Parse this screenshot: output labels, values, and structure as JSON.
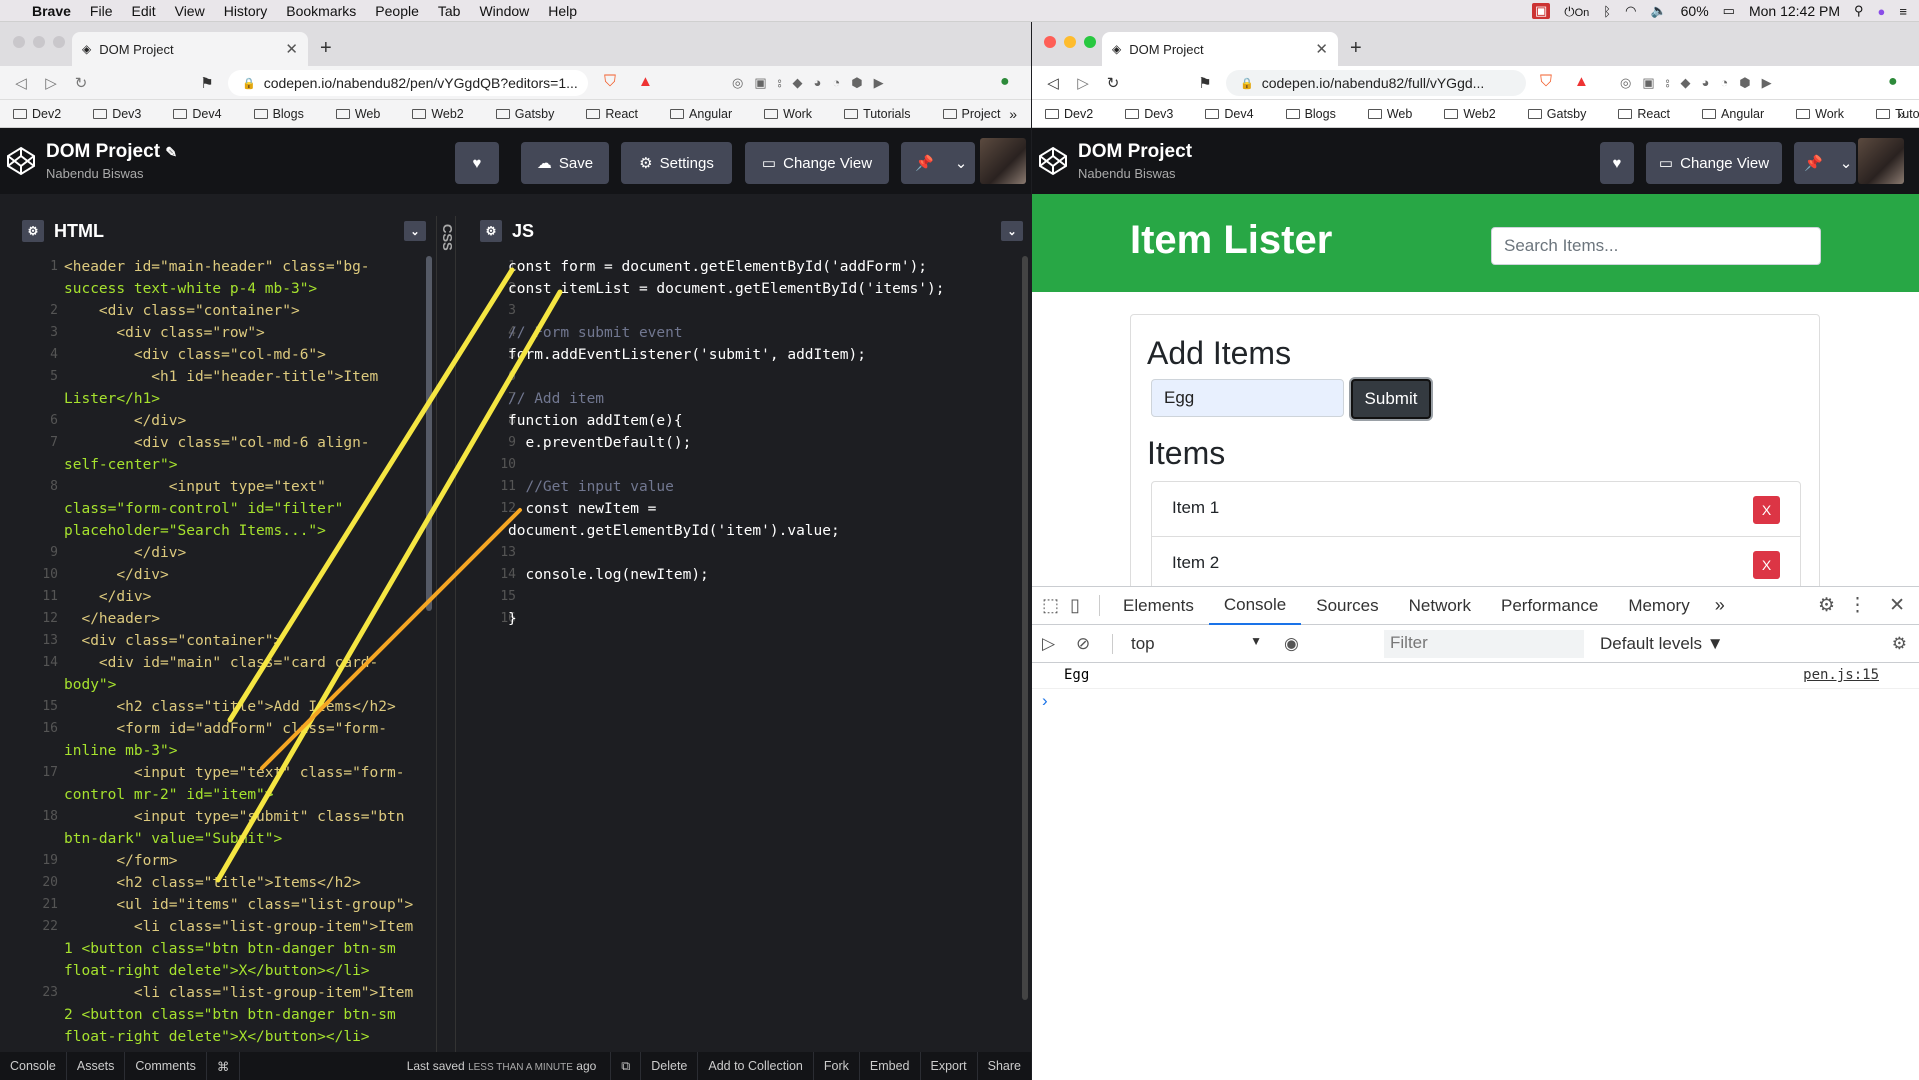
{
  "menubar": {
    "app": "Brave",
    "items": [
      "File",
      "Edit",
      "View",
      "History",
      "Bookmarks",
      "People",
      "Tab",
      "Window",
      "Help"
    ],
    "battery": "60%",
    "time": "Mon 12:42 PM",
    "vpn_label": "On"
  },
  "left_window": {
    "tab_title": "DOM Project",
    "url": "codepen.io/nabendu82/pen/vYGgdQB?editors=1...",
    "bookmarks": [
      "Dev2",
      "Dev3",
      "Dev4",
      "Blogs",
      "Web",
      "Web2",
      "Gatsby",
      "React",
      "Angular",
      "Work",
      "Tutorials",
      "Project"
    ],
    "project_title": "DOM Project",
    "author": "Nabendu Biswas",
    "buttons": {
      "save": "Save",
      "settings": "Settings",
      "change_view": "Change View"
    },
    "html_pane_title": "HTML",
    "css_pane_title": "CSS",
    "js_pane_title": "JS",
    "footer": {
      "console": "Console",
      "assets": "Assets",
      "comments": "Comments",
      "shortcut": "⌘",
      "last_saved_prefix": "Last saved",
      "last_saved_when": "LESS THAN A MINUTE",
      "last_saved_suffix": "ago",
      "delete": "Delete",
      "add_to_collection": "Add to Collection",
      "fork": "Fork",
      "embed": "Embed",
      "export": "Export",
      "share": "Share"
    }
  },
  "html_lines": [
    {
      "n": "1",
      "t": "<header id=\"main-header\" class=\"bg-"
    },
    {
      "n": "",
      "t": "success text-white p-4 mb-3\">"
    },
    {
      "n": "2",
      "t": "    <div class=\"container\">"
    },
    {
      "n": "3",
      "t": "      <div class=\"row\">"
    },
    {
      "n": "4",
      "t": "        <div class=\"col-md-6\">"
    },
    {
      "n": "5",
      "t": "          <h1 id=\"header-title\">Item"
    },
    {
      "n": "",
      "t": "Lister</h1>"
    },
    {
      "n": "6",
      "t": "        </div>"
    },
    {
      "n": "7",
      "t": "        <div class=\"col-md-6 align-"
    },
    {
      "n": "",
      "t": "self-center\">"
    },
    {
      "n": "8",
      "t": "            <input type=\"text\""
    },
    {
      "n": "",
      "t": "class=\"form-control\" id=\"filter\""
    },
    {
      "n": "",
      "t": "placeholder=\"Search Items...\">"
    },
    {
      "n": "9",
      "t": "        </div>"
    },
    {
      "n": "10",
      "t": "      </div>"
    },
    {
      "n": "11",
      "t": "    </div>"
    },
    {
      "n": "12",
      "t": "  </header>"
    },
    {
      "n": "13",
      "t": "  <div class=\"container\">"
    },
    {
      "n": "14",
      "t": "    <div id=\"main\" class=\"card card-"
    },
    {
      "n": "",
      "t": "body\">"
    },
    {
      "n": "15",
      "t": "      <h2 class=\"title\">Add Items</h2>"
    },
    {
      "n": "16",
      "t": "      <form id=\"addForm\" class=\"form-"
    },
    {
      "n": "",
      "t": "inline mb-3\">"
    },
    {
      "n": "17",
      "t": "        <input type=\"text\" class=\"form-"
    },
    {
      "n": "",
      "t": "control mr-2\" id=\"item\">"
    },
    {
      "n": "18",
      "t": "        <input type=\"submit\" class=\"btn"
    },
    {
      "n": "",
      "t": "btn-dark\" value=\"Submit\">"
    },
    {
      "n": "19",
      "t": "      </form>"
    },
    {
      "n": "20",
      "t": "      <h2 class=\"title\">Items</h2>"
    },
    {
      "n": "21",
      "t": "      <ul id=\"items\" class=\"list-group\">"
    },
    {
      "n": "22",
      "t": "        <li class=\"list-group-item\">Item"
    },
    {
      "n": "",
      "t": "1 <button class=\"btn btn-danger btn-sm"
    },
    {
      "n": "",
      "t": "float-right delete\">X</button></li>"
    },
    {
      "n": "23",
      "t": "        <li class=\"list-group-item\">Item"
    },
    {
      "n": "",
      "t": "2 <button class=\"btn btn-danger btn-sm"
    },
    {
      "n": "",
      "t": "float-right delete\">X</button></li>"
    }
  ],
  "js_lines": [
    {
      "n": "1",
      "t": "const form = document.getElementById('addForm');"
    },
    {
      "n": "2",
      "t": "const itemList = document.getElementById('items');"
    },
    {
      "n": "3",
      "t": ""
    },
    {
      "n": "4",
      "t": "// Form submit event"
    },
    {
      "n": "5",
      "t": "form.addEventListener('submit', addItem);"
    },
    {
      "n": "6",
      "t": ""
    },
    {
      "n": "7",
      "t": "// Add item"
    },
    {
      "n": "8",
      "t": "function addItem(e){"
    },
    {
      "n": "9",
      "t": "  e.preventDefault();"
    },
    {
      "n": "10",
      "t": ""
    },
    {
      "n": "11",
      "t": "  //Get input value"
    },
    {
      "n": "12",
      "t": "  const newItem ="
    },
    {
      "n": "",
      "t": "document.getElementById('item').value;"
    },
    {
      "n": "13",
      "t": ""
    },
    {
      "n": "14",
      "t": "  console.log(newItem);"
    },
    {
      "n": "15",
      "t": ""
    },
    {
      "n": "16",
      "t": "}"
    }
  ],
  "right_window": {
    "tab_title": "DOM Project",
    "url": "codepen.io/nabendu82/full/vYGgd...",
    "bookmarks": [
      "Dev2",
      "Dev3",
      "Dev4",
      "Blogs",
      "Web",
      "Web2",
      "Gatsby",
      "React",
      "Angular",
      "Work",
      "Tutorials"
    ],
    "project_title": "DOM Project",
    "author": "Nabendu Biswas",
    "change_view": "Change View",
    "page": {
      "header_title": "Item Lister",
      "search_placeholder": "Search Items...",
      "add_title": "Add Items",
      "item_value": "Egg",
      "submit": "Submit",
      "items_title": "Items",
      "items": [
        "Item 1",
        "Item 2"
      ],
      "delete_label": "X"
    },
    "devtools": {
      "tabs": [
        "Elements",
        "Console",
        "Sources",
        "Network",
        "Performance",
        "Memory"
      ],
      "active_tab": "Console",
      "context": "top",
      "filter_placeholder": "Filter",
      "levels": "Default levels ▼",
      "log_text": "Egg",
      "log_source": "pen.js:15"
    }
  },
  "colors": {
    "green": "#28a745",
    "danger": "#dc3545",
    "annotation_yellow": "#f5e642",
    "annotation_orange": "#f5a623"
  }
}
